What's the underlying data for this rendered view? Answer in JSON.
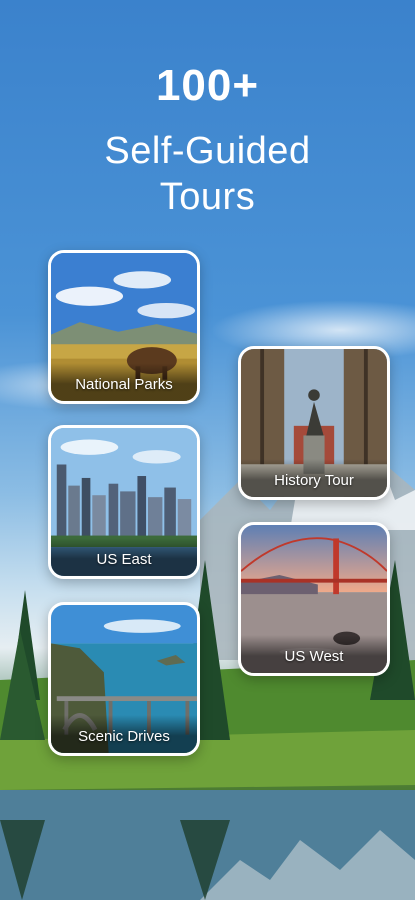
{
  "hero": {
    "count": "100+",
    "title_line1": "Self-Guided",
    "title_line2": "Tours"
  },
  "categories": [
    {
      "label": "National Parks"
    },
    {
      "label": "History Tour"
    },
    {
      "label": "US East"
    },
    {
      "label": "US West"
    },
    {
      "label": "Scenic Drives"
    }
  ],
  "colors": {
    "background_sky": "#3d86cf",
    "card_border": "#ffffff",
    "text": "#ffffff"
  }
}
